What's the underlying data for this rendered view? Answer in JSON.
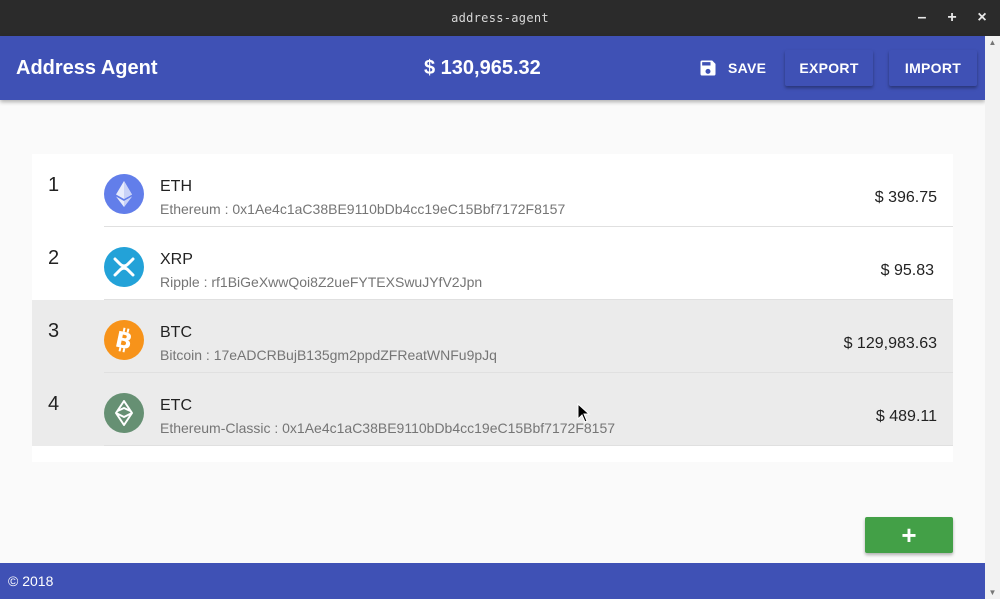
{
  "window": {
    "title": "address-agent",
    "minimize": "–",
    "maximize": "+",
    "close": "×"
  },
  "appbar": {
    "title": "Address Agent",
    "total": "$ 130,965.32",
    "save_label": "SAVE",
    "export_label": "EXPORT",
    "import_label": "IMPORT"
  },
  "wallets": [
    {
      "index": "1",
      "symbol": "ETH",
      "address": "Ethereum : 0x1Ae4c1aC38BE9110bDb4cc19eC15Bbf7172F8157",
      "value": "$ 396.75",
      "icon": "ethereum-icon",
      "color": "#627eea"
    },
    {
      "index": "2",
      "symbol": "XRP",
      "address": "Ripple : rf1BiGeXwwQoi8Z2ueFYTEXSwuJYfV2Jpn",
      "value": "$ 95.83",
      "icon": "ripple-icon",
      "color": "#23a2d8"
    },
    {
      "index": "3",
      "symbol": "BTC",
      "address": "Bitcoin : 17eADCRBujB135gm2ppdZFReatWNFu9pJq",
      "value": "$ 129,983.63",
      "icon": "bitcoin-icon",
      "color": "#f7931a"
    },
    {
      "index": "4",
      "symbol": "ETC",
      "address": "Ethereum-Classic : 0x1Ae4c1aC38BE9110bDb4cc19eC15Bbf7172F8157",
      "value": "$ 489.11",
      "icon": "ethereum-classic-icon",
      "color": "#669073"
    }
  ],
  "add_button": {
    "label": "+",
    "color": "#43a047"
  },
  "footer": {
    "text": "© 2018"
  },
  "colors": {
    "primary": "#3f51b5",
    "titlebar": "#2b2b2b"
  }
}
